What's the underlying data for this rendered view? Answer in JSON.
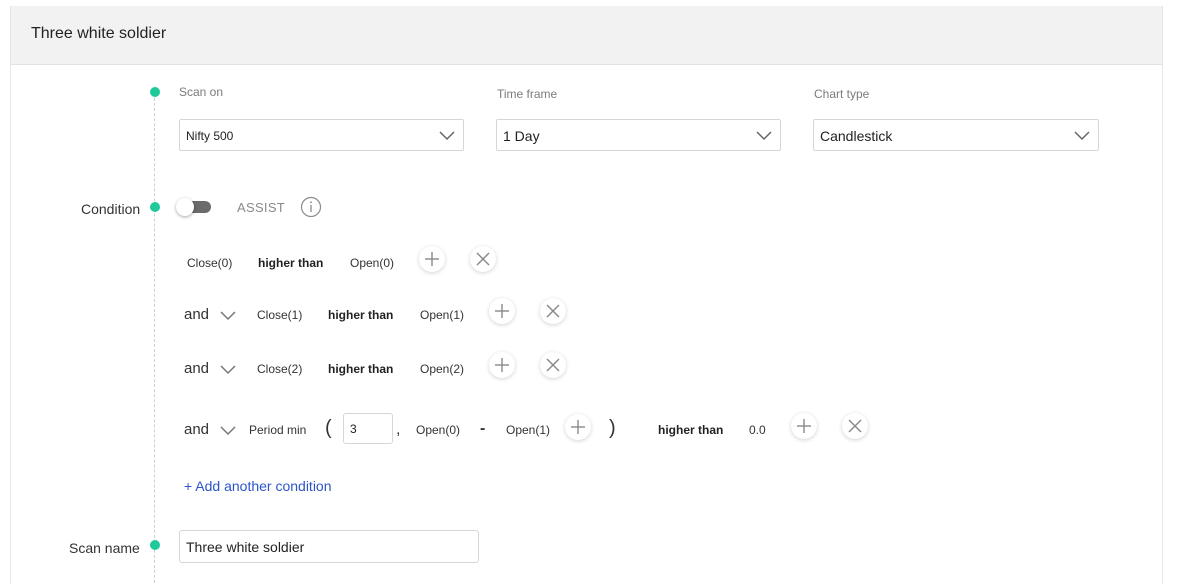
{
  "header": {
    "title": "Three white soldier"
  },
  "scan_on": {
    "label": "Scan on",
    "value": "Nifty 500"
  },
  "time_frame": {
    "label": "Time frame",
    "value": "1 Day"
  },
  "chart_type": {
    "label": "Chart type",
    "value": "Candlestick"
  },
  "condition": {
    "label": "Condition",
    "assist_label": "ASSIST",
    "rows": [
      {
        "left": "Close(0)",
        "op": "higher than",
        "right": "Open(0)"
      },
      {
        "joiner": "and",
        "left": "Close(1)",
        "op": "higher than",
        "right": "Open(1)"
      },
      {
        "joiner": "and",
        "left": "Close(2)",
        "op": "higher than",
        "right": "Open(2)"
      },
      {
        "joiner": "and",
        "func": "Period min",
        "open_paren": "(",
        "period": "3",
        "comma": ",",
        "a": "Open(0)",
        "minus": "-",
        "b": "Open(1)",
        "close_paren": ")",
        "op": "higher than",
        "right": "0.0"
      }
    ],
    "add_condition_label": "+ Add another condition"
  },
  "scan_name": {
    "label": "Scan name",
    "value": "Three white soldier"
  },
  "colors": {
    "accent_dot": "#1ec99a",
    "link": "#2b54c9"
  }
}
